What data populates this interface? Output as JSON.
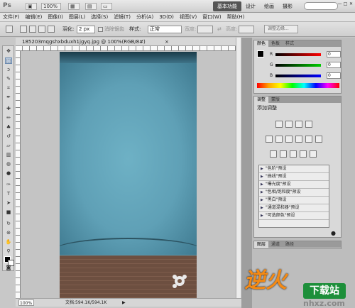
{
  "app": {
    "logo": "Ps",
    "zoom_dropdown": "100%",
    "workspaces": [
      "基本功能",
      "设计",
      "绘画",
      "摄影"
    ],
    "window_controls": [
      "—",
      "□",
      "✕"
    ]
  },
  "menu": [
    "文件(F)",
    "编辑(E)",
    "图像(I)",
    "图层(L)",
    "选择(S)",
    "滤镜(T)",
    "分析(A)",
    "3D(D)",
    "视图(V)",
    "窗口(W)",
    "帮助(H)"
  ],
  "options": {
    "feather_label": "羽化:",
    "feather_value": "2 px",
    "antialias_label": "消除锯齿",
    "style_label": "样式:",
    "style_value": "正常",
    "width_label": "宽度:",
    "height_label": "高度:",
    "refine_edge_button": "调整边缘..."
  },
  "document": {
    "tab_title": "185203mqgshxbduxh1jgyq.jpg @ 100%(RGB/8#)",
    "close": "×",
    "zoom": "100%",
    "doc_info": "文档:594.1K/594.1K"
  },
  "color_panel": {
    "tabs": [
      "颜色",
      "色板",
      "样式"
    ],
    "channels": [
      {
        "label": "R",
        "value": "0",
        "color": "#c22"
      },
      {
        "label": "G",
        "value": "0",
        "color": "#2a2"
      },
      {
        "label": "B",
        "value": "0",
        "color": "#22c"
      }
    ]
  },
  "adjust_panel": {
    "tabs": [
      "调整",
      "蒙版"
    ],
    "title": "添加调整",
    "presets": [
      "\"色阶\"预设",
      "\"曲线\"预设",
      "\"曝光度\"预设",
      "\"色相/饱和度\"预设",
      "\"黑白\"预设",
      "\"通道混和器\"预设",
      "\"可选颜色\"预设"
    ]
  },
  "layers_panel": {
    "tabs": [
      "图层",
      "通道",
      "路径"
    ]
  },
  "watermark": {
    "brand": "逆火",
    "download": "下载站",
    "site": "nhxz.com"
  },
  "colors": {
    "accent_workspace": "#555555",
    "image_sky": "#5d9ab0",
    "image_floor": "#6d4f40"
  }
}
